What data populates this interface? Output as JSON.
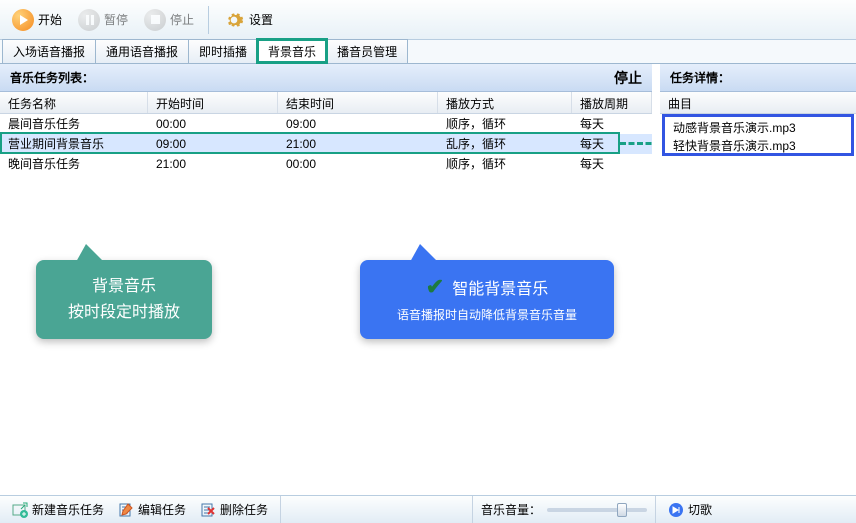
{
  "toolbar": {
    "start": "开始",
    "pause": "暂停",
    "stop": "停止",
    "settings": "设置"
  },
  "tabs": [
    {
      "label": "入场语音播报"
    },
    {
      "label": "通用语音播报"
    },
    {
      "label": "即时插播"
    },
    {
      "label": "背景音乐"
    },
    {
      "label": "播音员管理"
    }
  ],
  "active_tab": 3,
  "leftHeader": {
    "title": "音乐任务列表：",
    "status": "停止"
  },
  "columns": {
    "c1": "任务名称",
    "c2": "开始时间",
    "c3": "结束时间",
    "c4": "播放方式",
    "c5": "播放周期"
  },
  "rows": [
    {
      "name": "晨间音乐任务",
      "start": "00:00",
      "end": "09:00",
      "mode": "顺序，循环",
      "cycle": "每天"
    },
    {
      "name": "营业期间背景音乐",
      "start": "09:00",
      "end": "21:00",
      "mode": "乱序，循环",
      "cycle": "每天"
    },
    {
      "name": "晚间音乐任务",
      "start": "21:00",
      "end": "00:00",
      "mode": "顺序，循环",
      "cycle": "每天"
    }
  ],
  "selected_row": 1,
  "rightHeader": {
    "title": "任务详情："
  },
  "detailHeader": "曲目",
  "detailItems": [
    "动感背景音乐演示.mp3",
    "轻快背景音乐演示.mp3"
  ],
  "bottom": {
    "new": "新建音乐任务",
    "edit": "编辑任务",
    "del": "删除任务",
    "vol": "音乐音量：",
    "skip": "切歌"
  },
  "calloutGreen": {
    "l1": "背景音乐",
    "l2": "按时段定时播放"
  },
  "calloutBlue": {
    "title": "智能背景音乐",
    "sub": "语音播报时自动降低背景音乐音量"
  }
}
